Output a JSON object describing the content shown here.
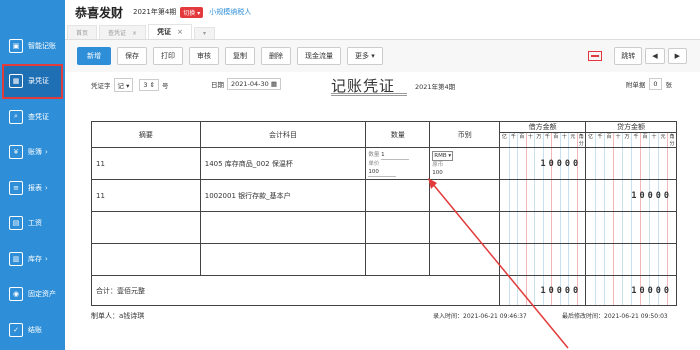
{
  "sidebar": {
    "items": [
      {
        "label": "智能记账",
        "icon": "monitor-icon",
        "glyph": "▣"
      },
      {
        "label": "录凭证",
        "icon": "calendar-icon",
        "glyph": "▦"
      },
      {
        "label": "查凭证",
        "icon": "search-icon",
        "glyph": "⌕"
      },
      {
        "label": "账簿",
        "icon": "yen-icon",
        "glyph": "¥",
        "has_arrow": true
      },
      {
        "label": "报表",
        "icon": "report-icon",
        "glyph": "≡",
        "has_arrow": true
      },
      {
        "label": "工资",
        "icon": "wage-icon",
        "glyph": "▤"
      },
      {
        "label": "库存",
        "icon": "inventory-icon",
        "glyph": "▥",
        "has_arrow": true
      },
      {
        "label": "固定资产",
        "icon": "asset-icon",
        "glyph": "◉"
      },
      {
        "label": "结账",
        "icon": "checkout-icon",
        "glyph": "✓"
      }
    ],
    "arrow_glyph": "›"
  },
  "header": {
    "company": "恭喜发财",
    "period": "2021年第4期",
    "switch_label": "切换 ▾",
    "taxpayer": "小规模纳税人"
  },
  "tabs": [
    {
      "label": "首页"
    },
    {
      "label": "查凭证",
      "close": "×"
    },
    {
      "label": "凭证",
      "close": "×",
      "active": true
    },
    {
      "label": "▾"
    }
  ],
  "toolbar": {
    "buttons": [
      "新增",
      "保存",
      "打印",
      "审核",
      "复制",
      "删除",
      "现金流量",
      "更多 ▾"
    ],
    "jump": "跳转",
    "prev": "◀",
    "next": "▶"
  },
  "voucher": {
    "word_label": "凭证字",
    "word_value": "记",
    "number_value": "3",
    "date_label": "日期",
    "date_value": "2021-04-30",
    "title": "记账凭证",
    "period": "2021年第4期",
    "attach_label": "附单据",
    "attach_value": "0",
    "attach_unit": "张"
  },
  "table": {
    "headers": {
      "summary": "摘要",
      "account": "会计科目",
      "qty": "数量",
      "currency": "币别",
      "debit": "借方金额",
      "credit": "贷方金额"
    },
    "digit_labels": [
      "亿",
      "千",
      "百",
      "十",
      "万",
      "千",
      "百",
      "十",
      "元",
      "角分"
    ],
    "rows": [
      {
        "summary": "11",
        "account": "1405  库存商品_002 保温杯",
        "qty_label": "数量",
        "qty_value": "1",
        "price_label": "单价",
        "price_value": "100",
        "currency_select": "RMB ▾",
        "currency_label": "原币",
        "currency_value": "100",
        "debit": "10000",
        "credit": ""
      },
      {
        "summary": "11",
        "account": "1002001  银行存款_基本户",
        "debit": "",
        "credit": "10000"
      },
      {
        "summary": "",
        "account": "",
        "debit": "",
        "credit": ""
      },
      {
        "summary": "",
        "account": "",
        "debit": "",
        "credit": ""
      }
    ],
    "total_label": "合计：壹佰元整",
    "total_debit": "10000",
    "total_credit": "10000"
  },
  "footer": {
    "maker": "制单人：a钱诗琪",
    "entry_time": "录入时间：2021-06-21 09:46:37",
    "modify_time": "最后修改时间：2021-06-21 09:50:03"
  },
  "colors": {
    "sidebar": "#2e8fd8",
    "highlight": "#e23b3b",
    "primary": "#2e8fd8"
  }
}
